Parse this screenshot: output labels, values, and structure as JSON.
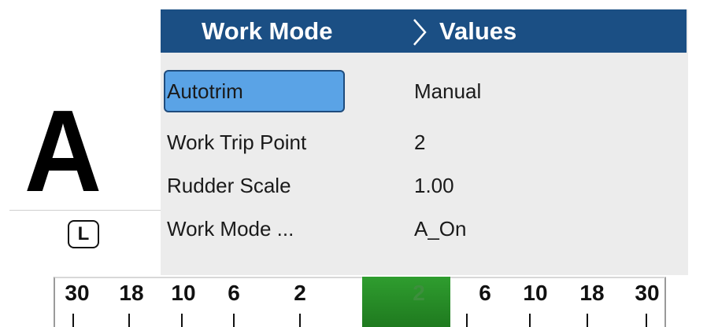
{
  "mode": {
    "letter": "A",
    "side_badge": "L"
  },
  "menu": {
    "header": {
      "col1": "Work Mode",
      "col2": "Values"
    },
    "rows": [
      {
        "label": "Autotrim",
        "value": "Manual",
        "selected": true
      },
      {
        "label": "Work Trip Point",
        "value": "2",
        "selected": false
      },
      {
        "label": "Rudder Scale",
        "value": "1.00",
        "selected": false
      },
      {
        "label": "Work Mode ...",
        "value": "A_On",
        "selected": false
      }
    ]
  },
  "rudder_scale": {
    "labels": [
      "30",
      "18",
      "10",
      "6",
      "2",
      "2",
      "6",
      "10",
      "18",
      "30"
    ],
    "center_indicator_color": "#2a8f2a"
  },
  "colors": {
    "header_bg": "#1b4f84",
    "selection_bg": "#5aa3e6",
    "panel_bg": "#ececec"
  }
}
